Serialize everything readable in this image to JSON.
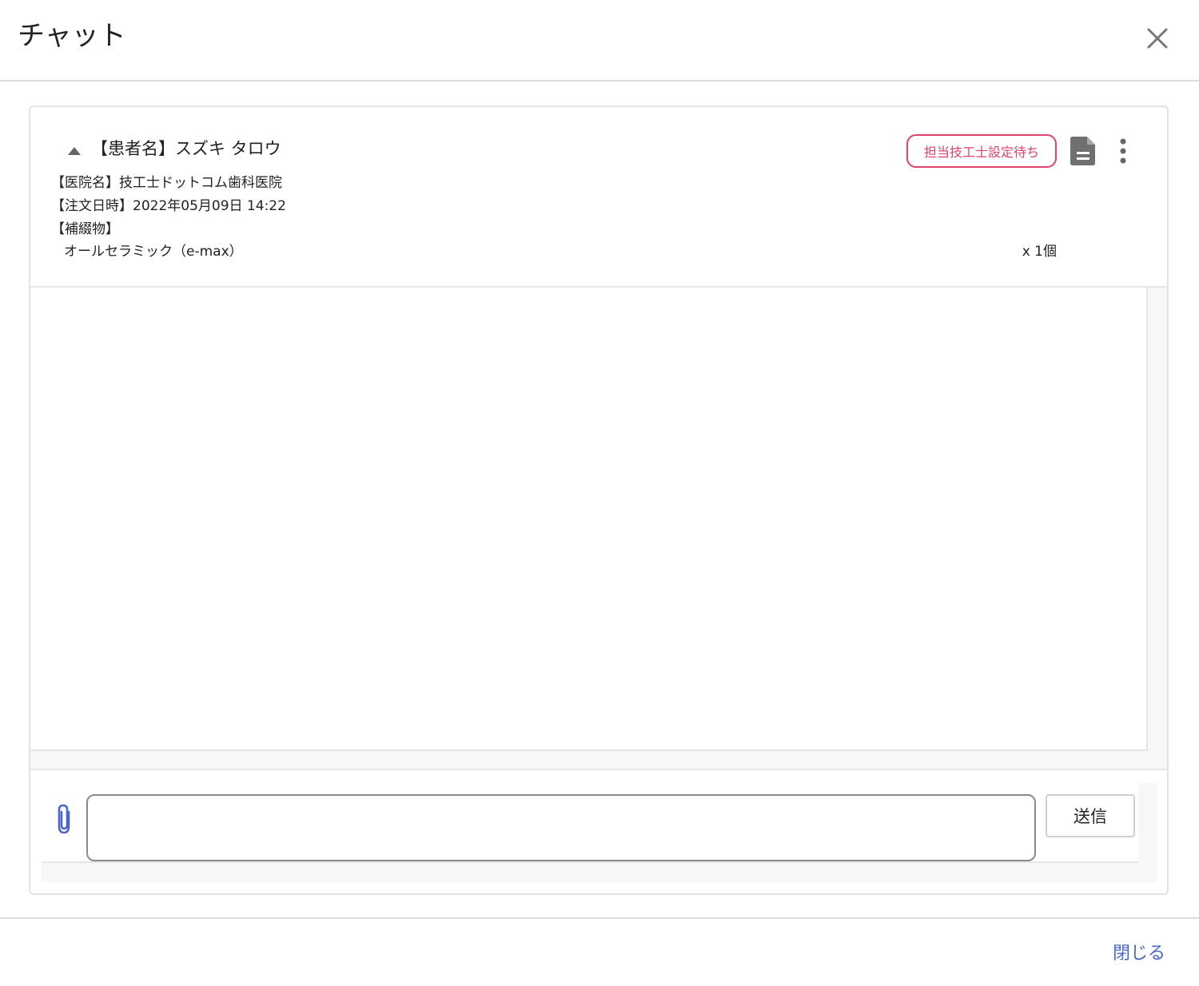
{
  "header": {
    "title": "チャット",
    "close_icon": "close-icon"
  },
  "order": {
    "patient_name": "【患者名】スズキ タロウ",
    "status_badge": "担当技工士設定待ち",
    "status_color": "#e0426b",
    "clinic": "【医院名】技工士ドットコム歯科医院",
    "order_datetime": "【注文日時】2022年05月09日 14:22",
    "prosthesis_label": "【補綴物】",
    "items": [
      {
        "name": "オールセラミック（e-max）",
        "quantity": "x 1個"
      }
    ]
  },
  "composer": {
    "message_value": "",
    "send_label": "送信"
  },
  "footer": {
    "close_label": "閉じる",
    "accent_color": "#4a67c8"
  }
}
